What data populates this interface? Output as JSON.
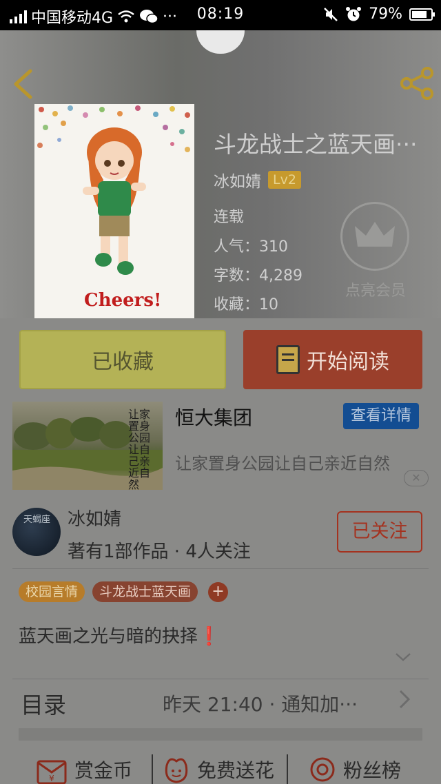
{
  "status_bar": {
    "carrier": "中国移动4G",
    "more": "···",
    "time": "08:19",
    "battery": "79%",
    "battery_level": 0.79
  },
  "book": {
    "title": "斗龙战士之蓝天画···",
    "author": "冰如婧",
    "level": "Lv2",
    "status": "连载",
    "popularity_label": "人气：310",
    "words_label": "字数：4,289",
    "favorites_label": "收藏：10",
    "cover_text": "Cheers!",
    "vip_label": "点亮会员"
  },
  "actions": {
    "collected_label": "已收藏",
    "read_label": "开始阅读"
  },
  "ad": {
    "title": "恒大集团",
    "detail_button": "查看详情",
    "description": "让家置身公园让自己亲近自然",
    "image_text": "让家置身公园让自己亲近自然",
    "close": "✕"
  },
  "writer": {
    "name": "冰如婧",
    "stats": "著有1部作品 · 4人关注",
    "follow_label": "已关注",
    "avatar_text": "天蝎座"
  },
  "tags": [
    "校园言情",
    "斗龙战士蓝天画"
  ],
  "tag_add": "+",
  "synopsis": "蓝天画之光与暗的抉择",
  "synopsis_mark": "❗",
  "toc": {
    "label": "目录",
    "update": "昨天 21:40 · 通知加···"
  },
  "bottom_actions": [
    "赏金币",
    "免费送花",
    "粉丝榜"
  ],
  "colors": {
    "read_button": "#9a3f2b",
    "collect_button": "#b4b256",
    "detail_button": "#134d92",
    "follow_border": "#a4321f"
  }
}
